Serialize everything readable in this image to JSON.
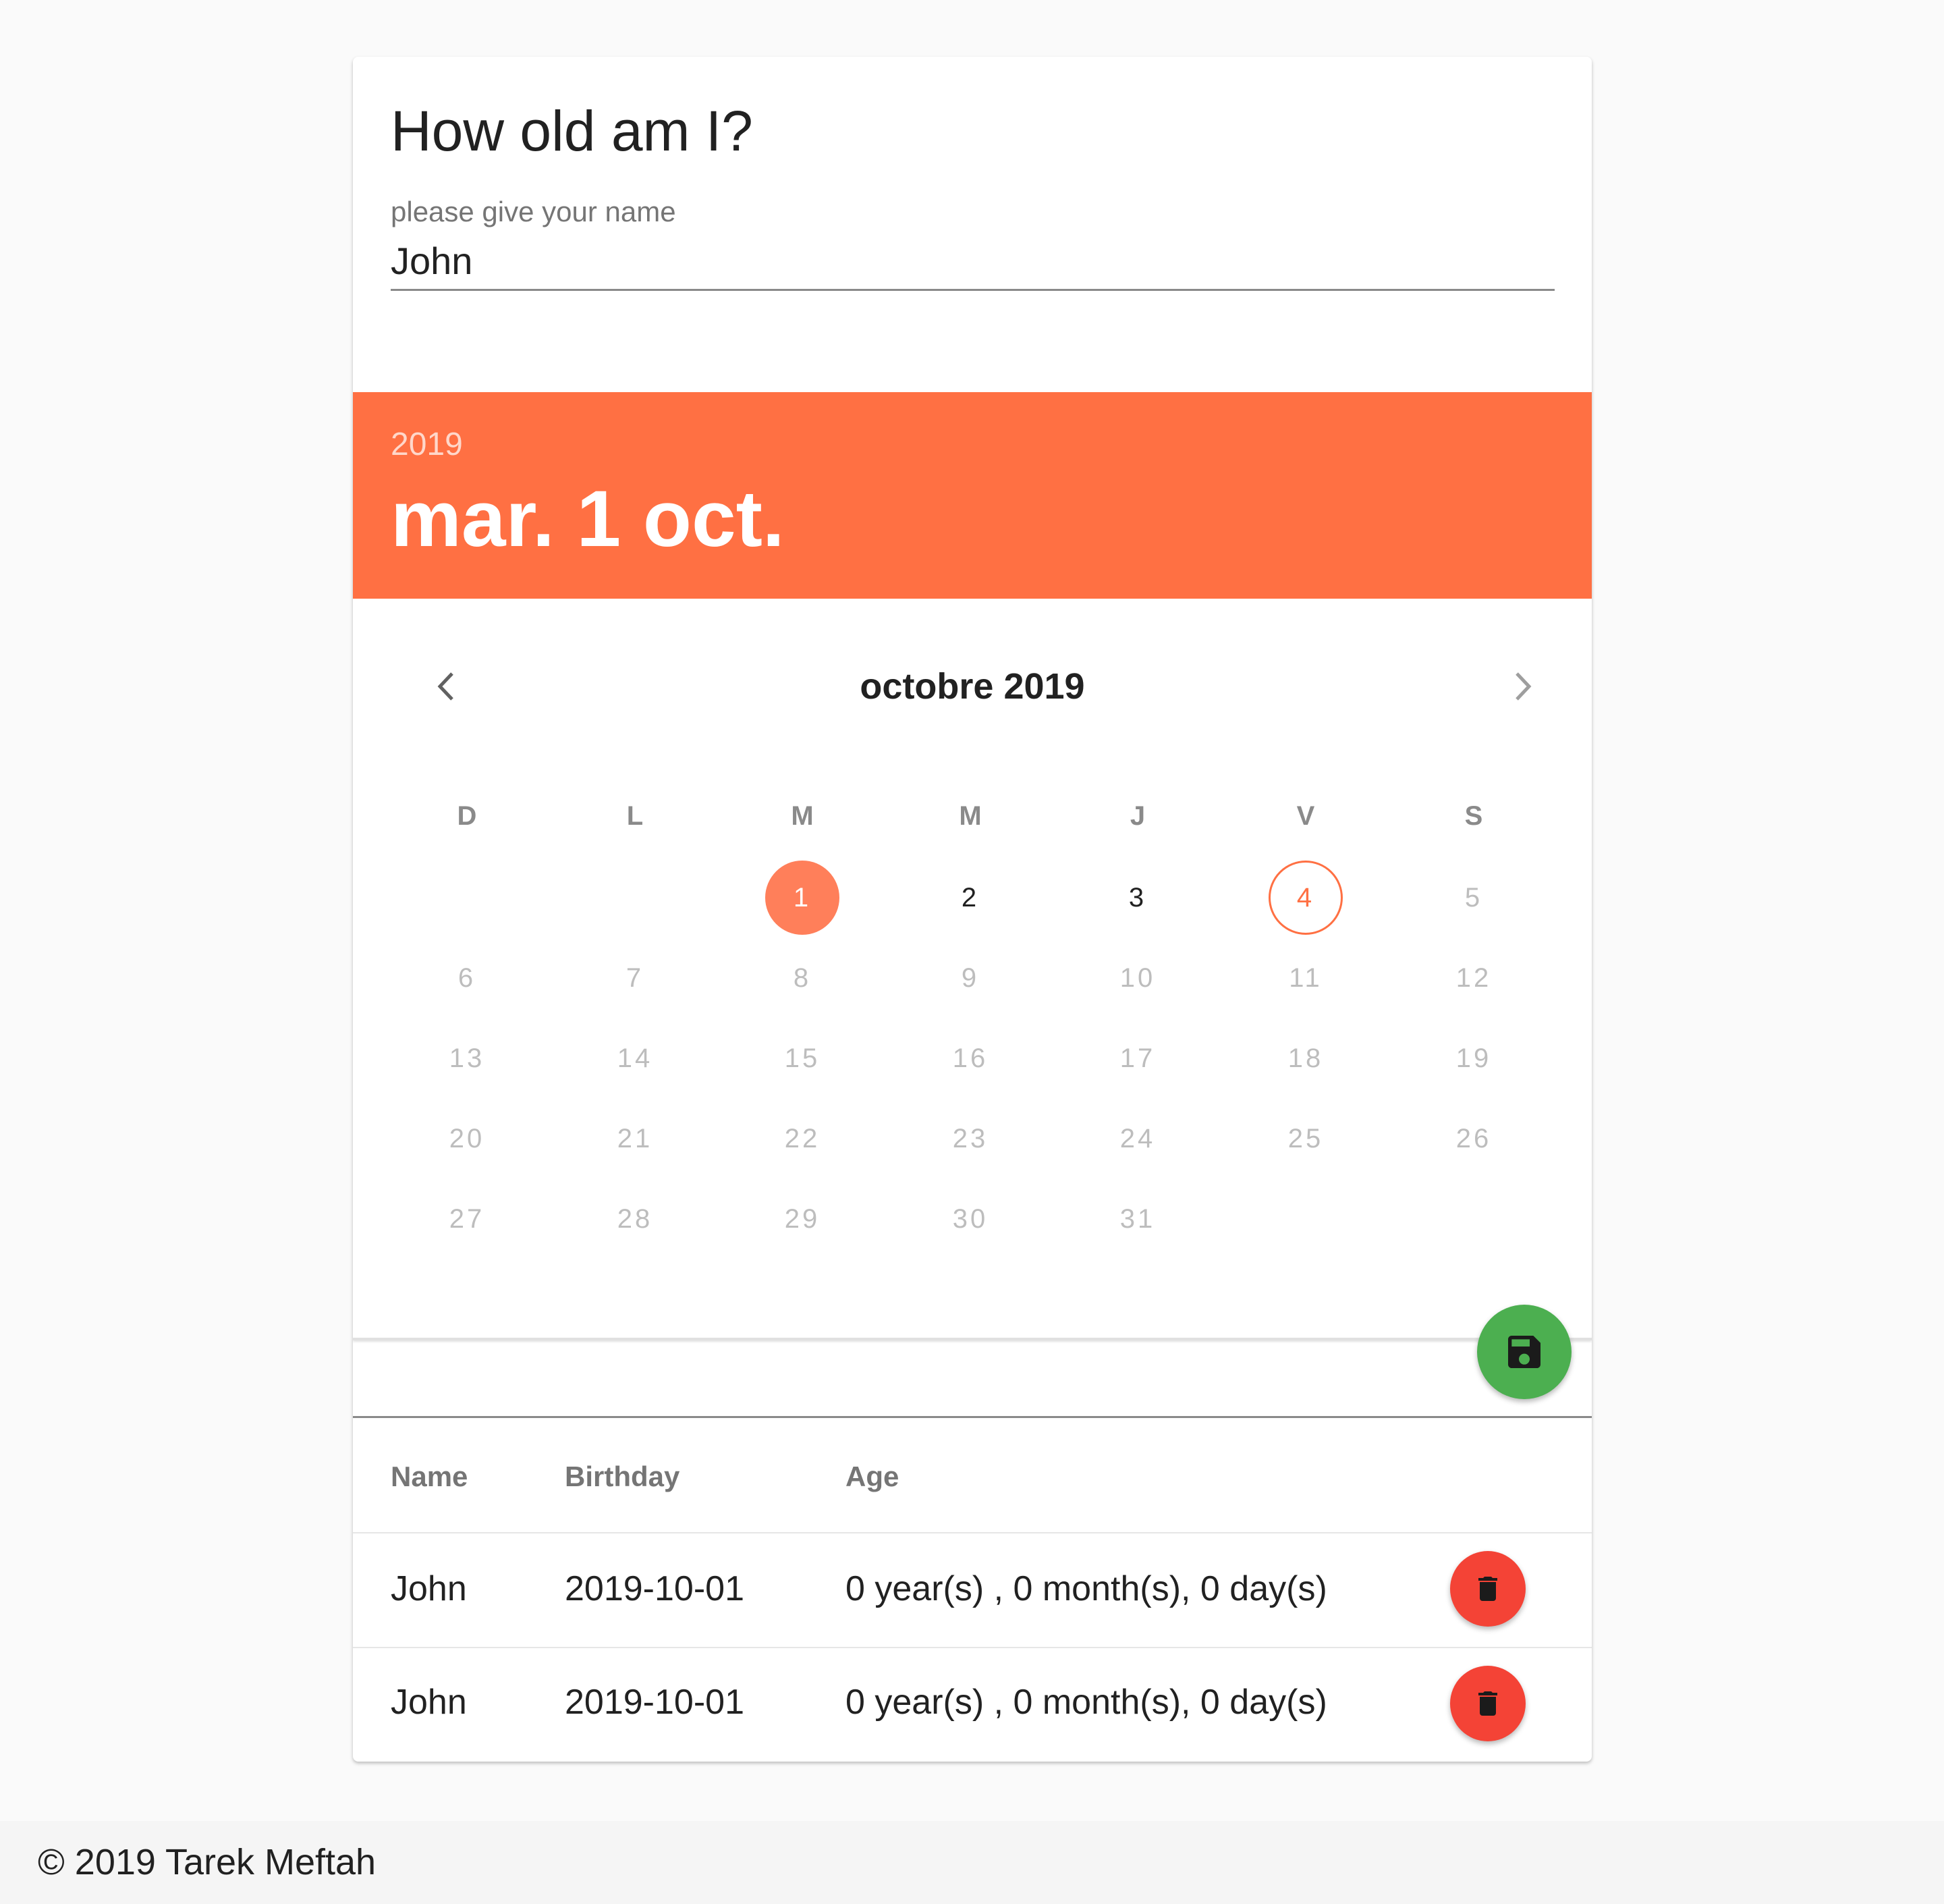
{
  "form": {
    "title": "How old am I?",
    "name_label": "please give your name",
    "name_value": "John"
  },
  "picker": {
    "header_year": "2019",
    "header_date": "mar. 1 oct.",
    "month_label": "octobre 2019",
    "weekdays": [
      "D",
      "L",
      "M",
      "M",
      "J",
      "V",
      "S"
    ],
    "days": [
      "1",
      "2",
      "3",
      "4",
      "5",
      "6",
      "7",
      "8",
      "9",
      "10",
      "11",
      "12",
      "13",
      "14",
      "15",
      "16",
      "17",
      "18",
      "19",
      "20",
      "21",
      "22",
      "23",
      "24",
      "25",
      "26",
      "27",
      "28",
      "29",
      "30",
      "31"
    ],
    "first_weekday_index": 2,
    "selected_day": "1",
    "today_day": "4",
    "enabled_days": [
      "1",
      "2",
      "3",
      "4"
    ],
    "accent_color": "#ff7043"
  },
  "save_button": {
    "icon": "floppy-disk-icon",
    "color": "#4caf50"
  },
  "table": {
    "headers": {
      "name": "Name",
      "birthday": "Birthday",
      "age": "Age"
    },
    "rows": [
      {
        "name": "John",
        "birthday": "2019-10-01",
        "age": "0 year(s) , 0 month(s), 0 day(s)"
      },
      {
        "name": "John",
        "birthday": "2019-10-01",
        "age": "0 year(s) , 0 month(s), 0 day(s)"
      }
    ],
    "delete_icon": "trash-icon",
    "delete_color": "#f44336"
  },
  "footer": {
    "text": "© 2019 Tarek Meftah"
  }
}
